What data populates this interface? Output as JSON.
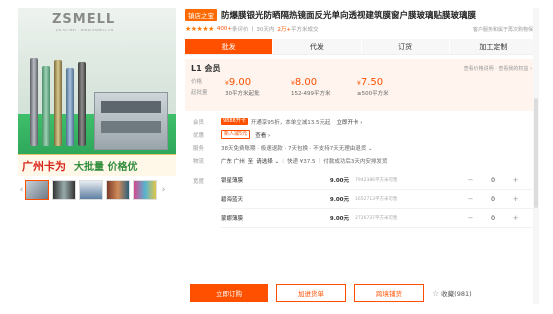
{
  "gallery": {
    "brand": "ZSMELL",
    "brand_sub": "JIN SU MEI · WWW.ZSMELL.CN",
    "slogan_1": "广州卡为",
    "slogan_2": "大批量 价格优",
    "prev_icon": "chevron-left-icon",
    "next_icon": "chevron-right-icon"
  },
  "header": {
    "badge": "镇店之宝",
    "title": "防爆膜银光防晒隔热镜面反光单向透视建筑膜窗户膜玻璃贴膜玻璃膜",
    "rating_stars": "★★★★★",
    "reviews": "400+",
    "reviews_label": "条评价",
    "deals_label": "30天内",
    "deals_count": "2万+",
    "deals_unit": "平方米成交",
    "right_note": "客户服务和属于再次购物保障"
  },
  "tabs": [
    {
      "label": "批发",
      "active": true
    },
    {
      "label": "代发",
      "active": false
    },
    {
      "label": "订货",
      "active": false
    },
    {
      "label": "加工定制",
      "active": false
    }
  ],
  "price_box": {
    "member": "L1 会员",
    "right": "查看价格说明 · 查看我的权益 ›",
    "label_price": "价格",
    "label_moq": "起批量",
    "tiers": [
      {
        "currency": "¥",
        "price": "9.00",
        "qty": "30平方米起批"
      },
      {
        "currency": "¥",
        "price": "8.00",
        "qty": "152-499平方米"
      },
      {
        "currency": "¥",
        "price": "7.50",
        "qty": "≥500平方米"
      }
    ]
  },
  "rows": {
    "member_label": "会员",
    "member_pill": "9888开卡",
    "member_text": "开通享95折，本单立减13.5元起",
    "member_link": "立即开卡 ›",
    "promo_label": "优惠",
    "promo_pill": "新人减5元",
    "promo_link": "查看 ›",
    "service_label": "服务",
    "service_text": "38天免费账期 · 极速退款 · 7天包换 · 不支持7天无理由退货 ⌄",
    "ship_label": "物流",
    "ship_from": "广东 广州",
    "ship_to_label": "至",
    "ship_to": "请选择 ⌄",
    "ship_fee": "快递 ¥37.5",
    "ship_promise": "付款成功后3天内安排发货"
  },
  "specs": {
    "label": "宽度",
    "items": [
      {
        "name": "银星薄膜",
        "price": "9.00元",
        "stock": "7942386平方米可售",
        "qty": "0"
      },
      {
        "name": "碧海蓝天",
        "price": "9.00元",
        "stock": "1652713平方米可售",
        "qty": "0"
      },
      {
        "name": "蒙娜薄膜",
        "price": "9.00元",
        "stock": "2726737平方米可售",
        "qty": "0"
      }
    ]
  },
  "actions": {
    "order": "立即订购",
    "cart": "加进货单",
    "sample": "跨境铺货",
    "fav_icon": "star-icon",
    "fav": "收藏(981)"
  },
  "colors": {
    "accent": "#ff5000",
    "price_bg": "#fff4ee",
    "badge": "#ff6a00"
  }
}
